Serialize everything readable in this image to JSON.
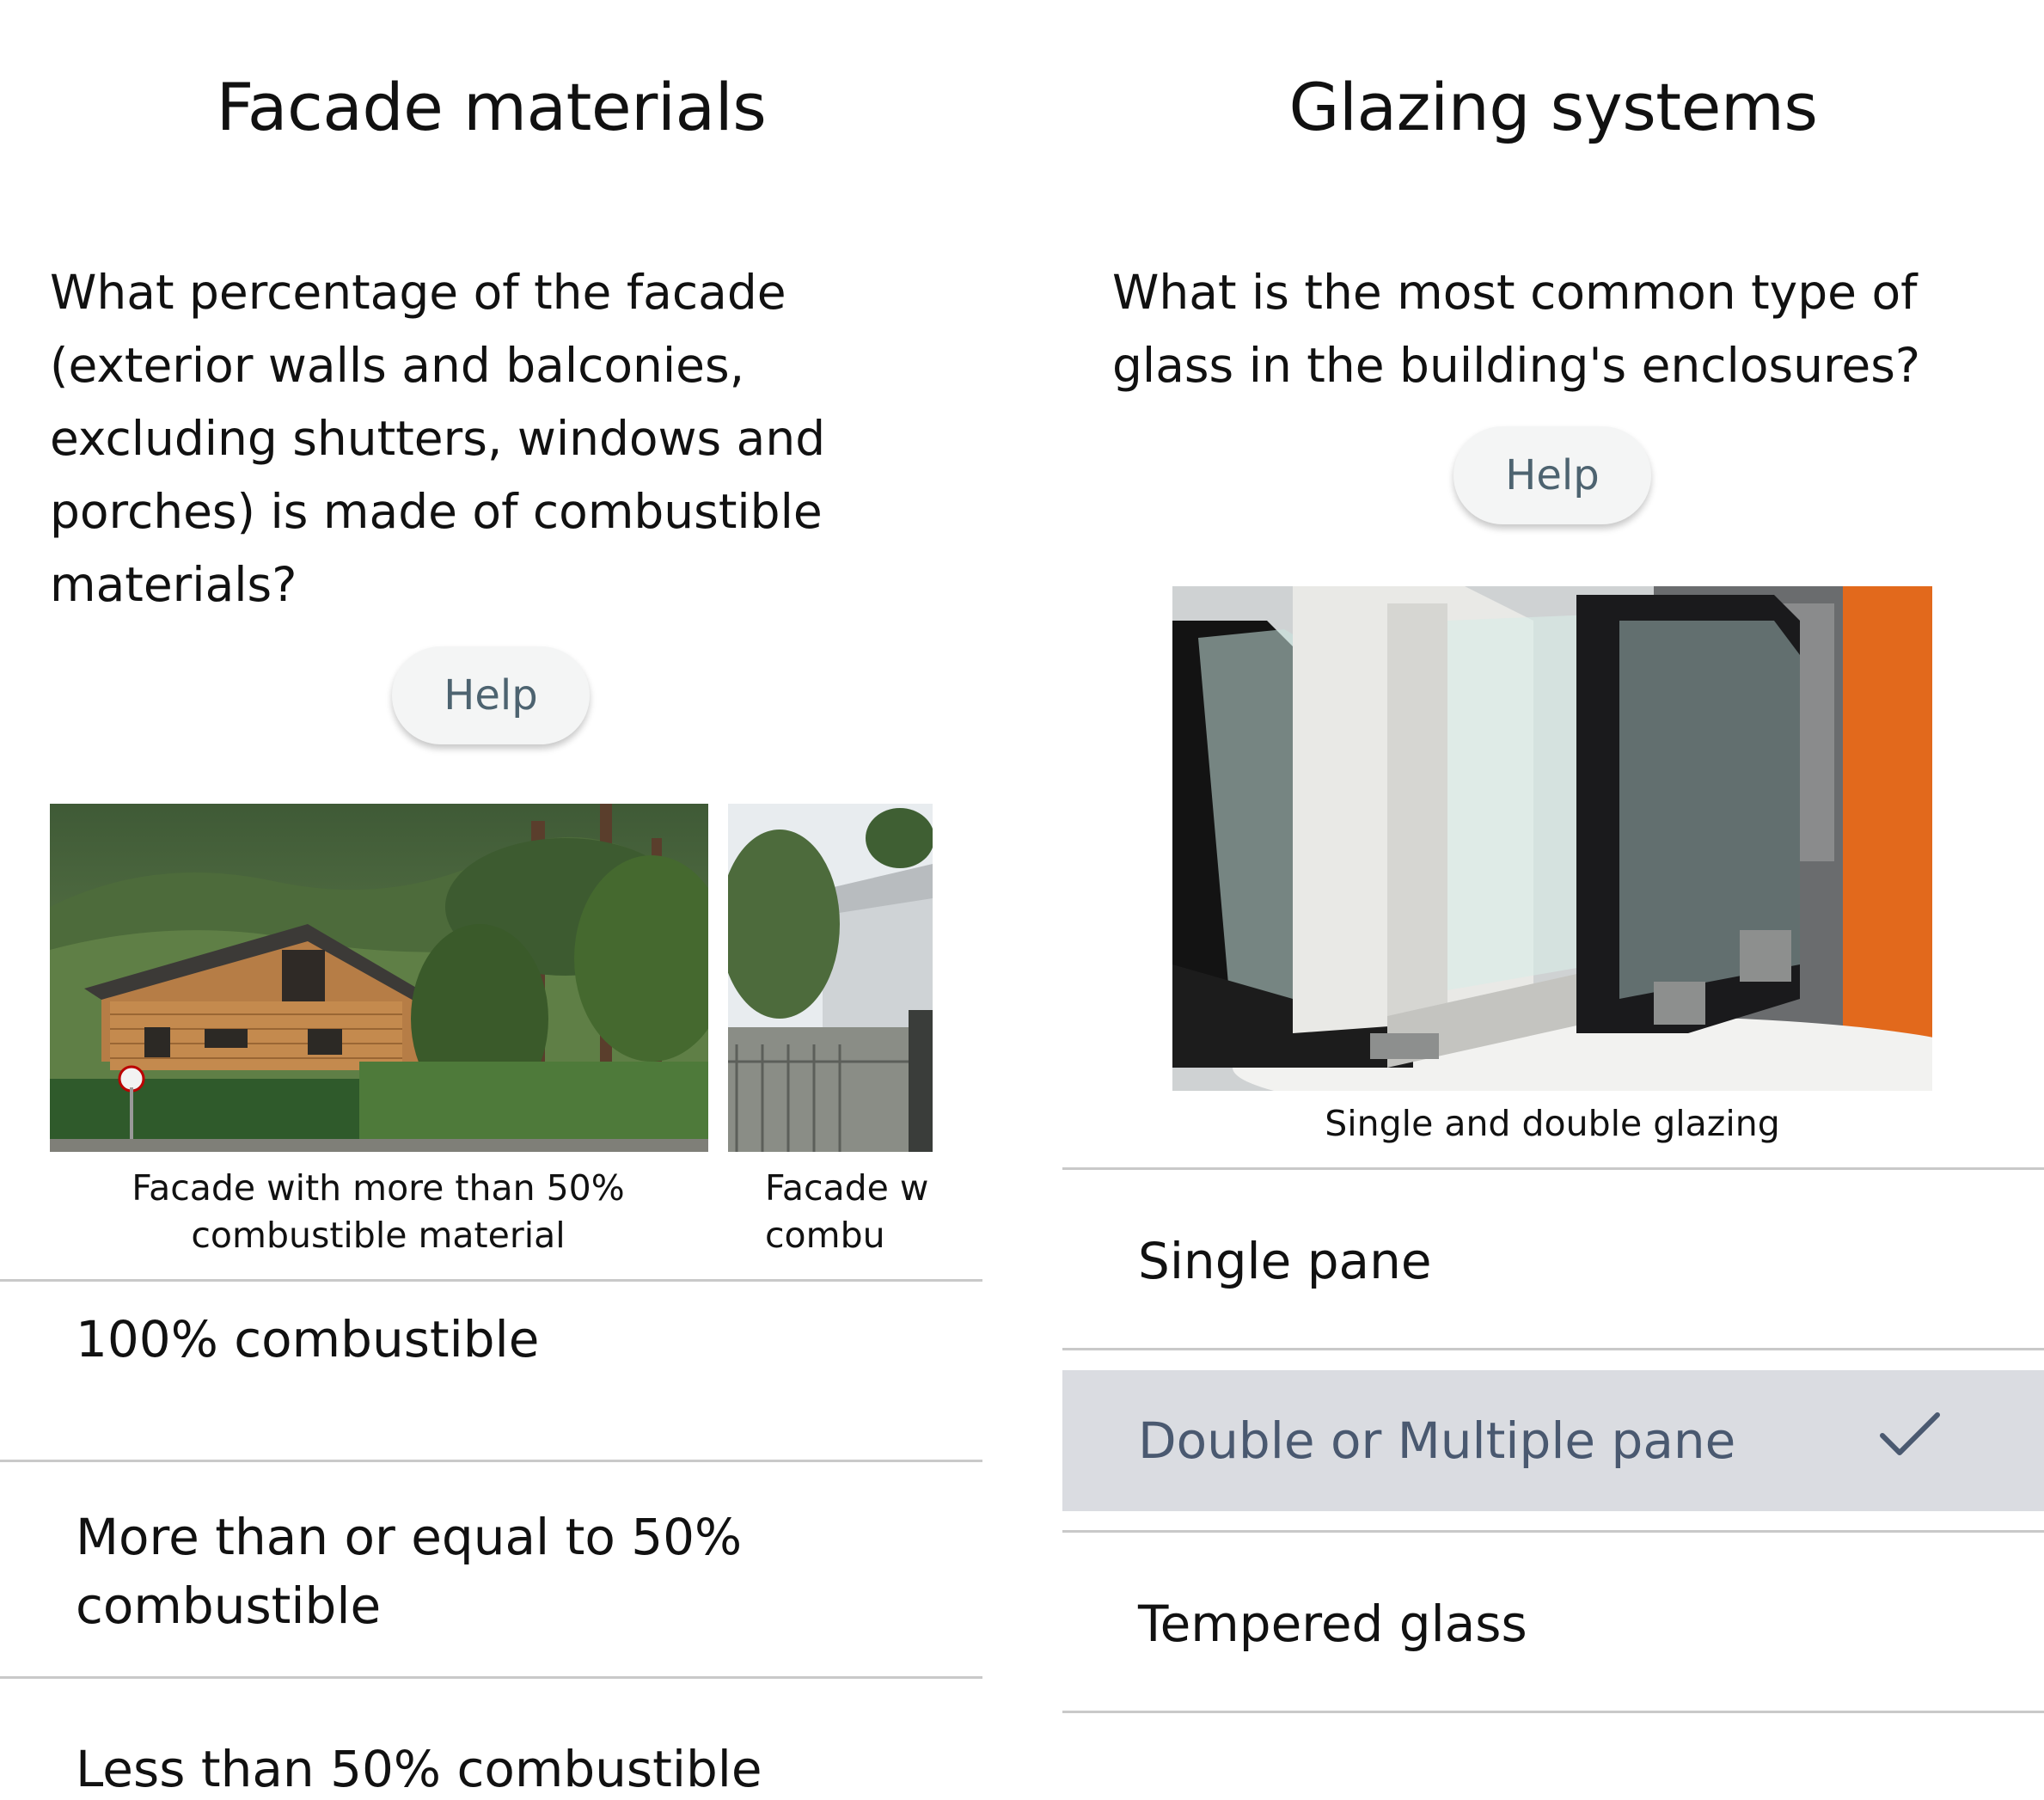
{
  "facade": {
    "title": "Facade materials",
    "question": "What percentage of the facade (exterior walls and balconies, excluding shutters, windows and porches) is made of combustible materials?",
    "help_label": "Help",
    "carousel": [
      {
        "caption": "Facade with more than 50% combustible material"
      },
      {
        "caption": "Facade w combu"
      }
    ],
    "options": [
      {
        "label": "100% combustible"
      },
      {
        "label": "More than or equal to 50% combustible"
      },
      {
        "label": "Less than 50% combustible"
      }
    ]
  },
  "glazing": {
    "title": "Glazing systems",
    "question": "What is the most common type of glass in the building's enclosures?",
    "help_label": "Help",
    "image_caption": "Single and double glazing",
    "options": [
      {
        "label": "Single pane",
        "selected": false
      },
      {
        "label": "Double or Multiple pane",
        "selected": true
      },
      {
        "label": "Tempered glass",
        "selected": false
      }
    ],
    "check_icon": "check-icon"
  },
  "colors": {
    "selected_bg": "#dadce1",
    "selected_text": "#4a5970",
    "help_text": "#4d6370",
    "divider": "#c9c9c9"
  }
}
